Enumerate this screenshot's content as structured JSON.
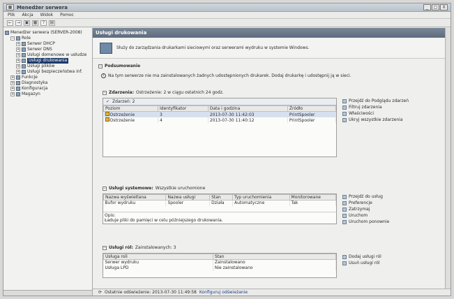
{
  "window": {
    "title": "Menedżer serwera",
    "controls": [
      "_",
      "□",
      "X"
    ]
  },
  "menu": [
    "Plik",
    "Akcja",
    "Widok",
    "Pomoc"
  ],
  "toolbar": [
    "←",
    "→",
    "▣",
    "▦",
    "?",
    "▤"
  ],
  "tree": [
    {
      "label": "Menedżer serwera (SERVER-2008)",
      "indent": 0,
      "exp": "",
      "sel": false
    },
    {
      "label": "Role",
      "indent": 1,
      "exp": "−",
      "sel": false
    },
    {
      "label": "Serwer DHCP",
      "indent": 2,
      "exp": "+",
      "sel": false
    },
    {
      "label": "Serwer DNS",
      "indent": 2,
      "exp": "+",
      "sel": false
    },
    {
      "label": "Usługi domenowe w usłudze",
      "indent": 2,
      "exp": "+",
      "sel": false
    },
    {
      "label": "Usługi drukowania",
      "indent": 2,
      "exp": "+",
      "sel": true
    },
    {
      "label": "Usługi plików",
      "indent": 2,
      "exp": "+",
      "sel": false
    },
    {
      "label": "Usługi bezpieczeństwa inf.",
      "indent": 2,
      "exp": "+",
      "sel": false
    },
    {
      "label": "Funkcje",
      "indent": 1,
      "exp": "+",
      "sel": false
    },
    {
      "label": "Diagnostyka",
      "indent": 1,
      "exp": "+",
      "sel": false
    },
    {
      "label": "Konfiguracja",
      "indent": 1,
      "exp": "+",
      "sel": false
    },
    {
      "label": "Magazyn",
      "indent": 1,
      "exp": "+",
      "sel": false
    }
  ],
  "main": {
    "header": "Usługi drukowania",
    "description": "Służy do zarządzania drukarkami sieciowymi oraz serwerami wydruku w systemie Windows.",
    "summary_title": "Podsumowanie",
    "summary_text": "Na tym serwerze nie ma zainstalowanych żadnych udostępnionych drukarek. Dodaj drukarkę i udostępnij ją w sieci.",
    "events": {
      "title": "Zdarzenia:",
      "subtitle": "Ostrzeżenie: 2 w ciągu ostatnich 24 godz.",
      "filter": "Zdarzeń: 2",
      "columns": [
        "Poziom",
        "Identyfikator",
        "Data i godzina",
        "Źródło"
      ],
      "rows": [
        [
          "Ostrzeżenie",
          "3",
          "2013-07-30 11:42:03",
          "PrintSpooler"
        ],
        [
          "Ostrzeżenie",
          "4",
          "2013-07-30 11:40:12",
          "PrintSpooler"
        ]
      ]
    },
    "event_tasks": [
      "Przejdź do Podglądu zdarzeń",
      "Filtruj zdarzenia",
      "Właściwości",
      "Ukryj wszystkie zdarzenia"
    ],
    "services": {
      "title": "Usługi systemowe:",
      "subtitle": "Wszystkie uruchomione",
      "columns": [
        "Nazwa wyświetlana",
        "Nazwa usługi",
        "Stan",
        "Typ uruchomienia",
        "Monitorowane"
      ],
      "rows": [
        [
          "Bufor wydruku",
          "Spooler",
          "Działa",
          "Automatyczne",
          "Tak"
        ]
      ],
      "desc_label": "Opis:",
      "desc_text": "Ładuje pliki do pamięci w celu późniejszego drukowania."
    },
    "service_tasks": [
      "Przejdź do usług",
      "Preferencje",
      "Zatrzymaj",
      "Uruchom",
      "Uruchom ponownie"
    ],
    "role_services": {
      "title": "Usługi ról:",
      "subtitle": "Zainstalowanych: 3",
      "columns": [
        "Usługa roli",
        "Stan"
      ],
      "rows": [
        [
          "Serwer wydruku",
          "Zainstalowano"
        ],
        [
          "Usługa LPD",
          "Nie zainstalowano"
        ]
      ]
    },
    "role_tasks": [
      "Dodaj usługi ról",
      "Usuń usługi ról"
    ],
    "status": "Ostatnie odświeżenie: 2013-07-30 11:49:58",
    "status_link": "Konfiguruj odświeżanie"
  }
}
